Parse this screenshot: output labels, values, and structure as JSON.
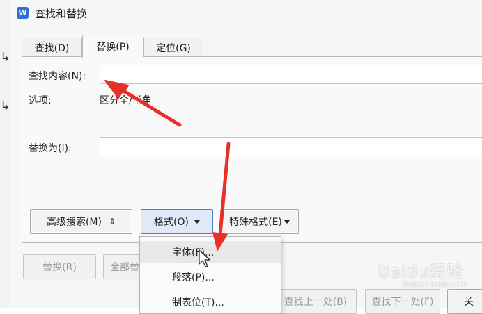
{
  "window": {
    "title": "查找和替换",
    "app_icon_letter": "W"
  },
  "tabs": [
    {
      "label": "查找(D)",
      "active": false
    },
    {
      "label": "替换(P)",
      "active": true
    },
    {
      "label": "定位(G)",
      "active": false
    }
  ],
  "find": {
    "label": "查找内容(N):",
    "value": ""
  },
  "options": {
    "label": "选项:",
    "value": "区分全/半角"
  },
  "replace": {
    "label": "替换为(I):",
    "value": ""
  },
  "buttons": {
    "advanced": "高级搜索(M)",
    "format": "格式(O)",
    "special": "特殊格式(E)",
    "replace": "替换(R)",
    "replace_all": "全部替",
    "find_prev": "查找上一处(B)",
    "find_next": "查找下一处(F)",
    "close_partial": "关"
  },
  "format_menu": {
    "items": [
      {
        "label": "字体(F)...",
        "hover": true
      },
      {
        "label": "段落(P)...",
        "hover": false
      },
      {
        "label": "制表位(T)...",
        "hover": false
      }
    ]
  },
  "watermark": {
    "main": "Baidu经验",
    "sub": "jingyan.baidu.com"
  },
  "annotation_color": "#e8302a"
}
